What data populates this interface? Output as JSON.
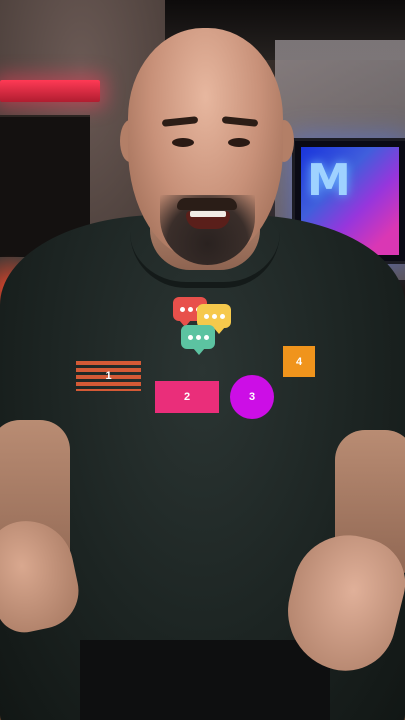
{
  "scene": {
    "description_colors": {
      "shirt": "#1c2422",
      "background": "#1a1614"
    }
  },
  "overlay": {
    "chat_icons": [
      {
        "name": "chat-bubble-red-icon",
        "color": "#e8504b"
      },
      {
        "name": "chat-bubble-yellow-icon",
        "color": "#f6c94c"
      },
      {
        "name": "chat-bubble-green-icon",
        "color": "#5cc3a1"
      }
    ],
    "shapes": [
      {
        "label": "1",
        "shape": "striped-rectangle",
        "color": "#d45a36"
      },
      {
        "label": "2",
        "shape": "rectangle",
        "color": "#ea2e7a"
      },
      {
        "label": "3",
        "shape": "circle",
        "color": "#cc0ee6"
      },
      {
        "label": "4",
        "shape": "square",
        "color": "#f0941c"
      }
    ]
  }
}
